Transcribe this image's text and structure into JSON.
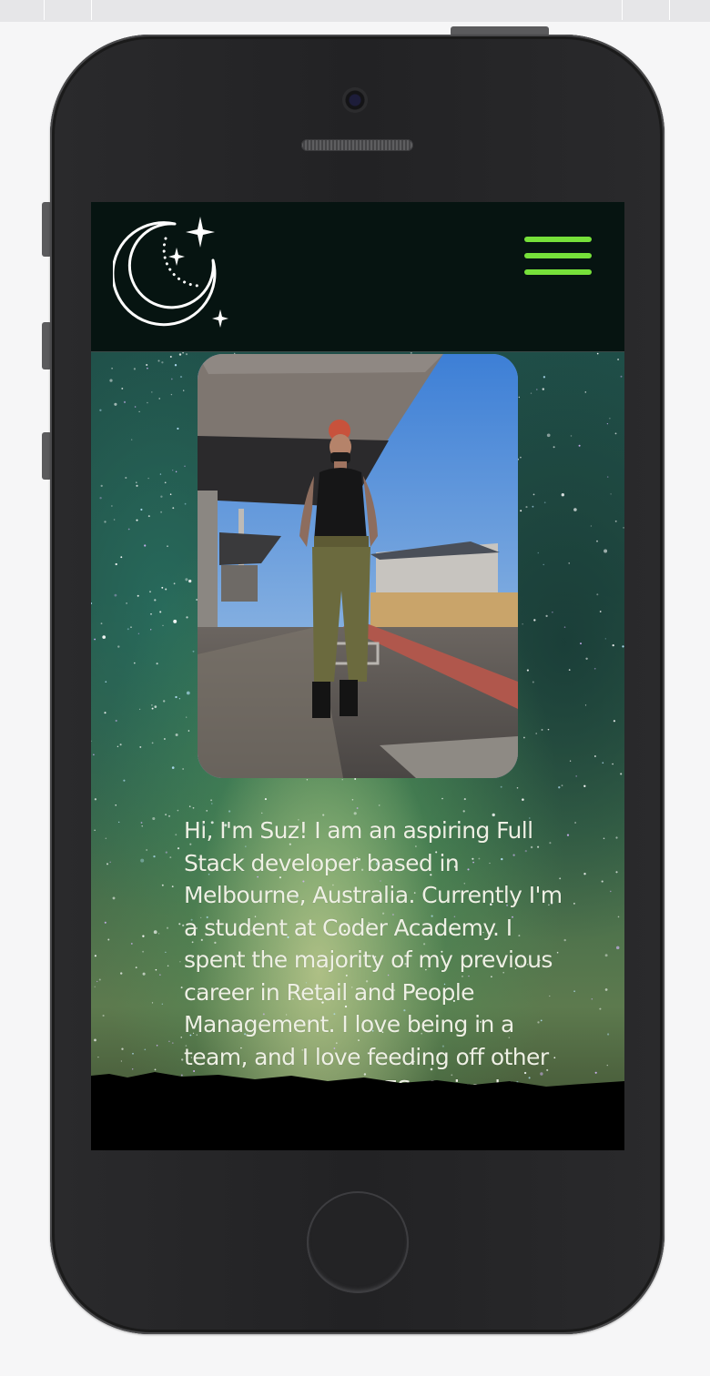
{
  "colors": {
    "page_background": "#f6f6f7",
    "device_body": "#222224",
    "navbar_background": "#061411",
    "hamburger_accent": "#76e03a",
    "bio_text": "#eef0e4"
  },
  "navbar": {
    "logo_icon": "crescent-moon-stars-icon",
    "menu_icon": "hamburger-menu-icon"
  },
  "hero": {
    "background_icon": "starry-night-sky",
    "photo_icon": "profile-photo-train-platform",
    "bio": "Hi, I'm Suz! I am an aspiring Full Stack developer based in Melbourne, Australia. Currently I'm a student at Coder Academy. I spent the majority of my previous career in Retail and People Management. I love being in a team, and I love feeding off other professionals. LOVES: Animals, Challenges, Travelling"
  }
}
